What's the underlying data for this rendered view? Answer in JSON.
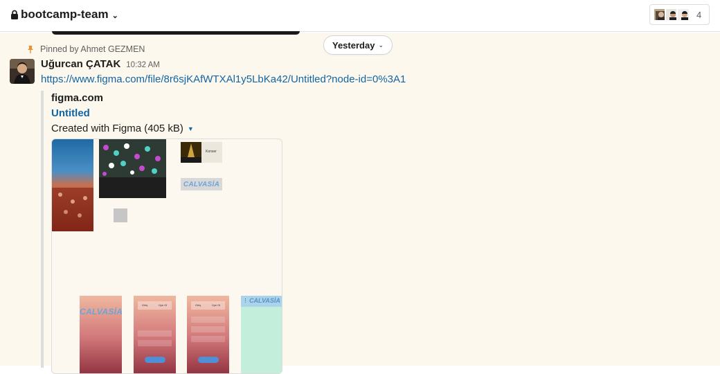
{
  "header": {
    "channel_name": "bootcamp-team",
    "member_count": "4",
    "icons": [
      "lock-icon",
      "chevron-down-icon"
    ]
  },
  "divider": {
    "date_label": "Yesterday"
  },
  "message": {
    "pinned_by": "Pinned by Ahmet GEZMEN",
    "sender": "Uğurcan ÇATAK",
    "time": "10:32 AM",
    "link": "https://www.figma.com/file/8r6sjKAfWTXAl1y5LbKa42/Untitled?node-id=0%3A1",
    "unfurl": {
      "site": "figma.com",
      "title": "Untitled",
      "description": "Created with Figma (405 kB)",
      "preview_labels": {
        "konser": "Konser",
        "logo": "CALVASİA",
        "screen_logo": "CALVASİA",
        "screen_tab_a": "Giriş",
        "screen_tab_b": "Üye Ol"
      }
    }
  },
  "colors": {
    "link": "#1264a3",
    "highlight_bg": "#fdf8ed",
    "pin": "#e8912d"
  }
}
